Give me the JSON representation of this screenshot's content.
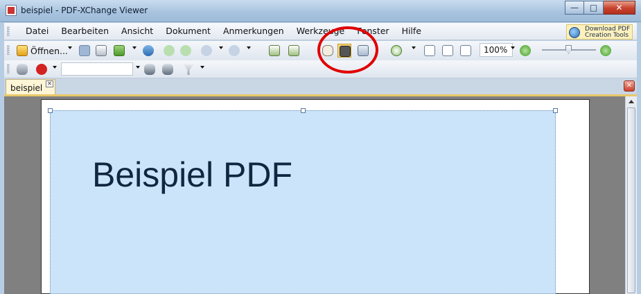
{
  "window": {
    "title": "beispiel - PDF-XChange Viewer"
  },
  "window_controls": {
    "minimize": "—",
    "maximize": "□",
    "close": "✕"
  },
  "menu": {
    "items": [
      "Datei",
      "Bearbeiten",
      "Ansicht",
      "Dokument",
      "Anmerkungen",
      "Werkzeuge",
      "Fenster",
      "Hilfe"
    ]
  },
  "download": {
    "line1": "Download PDF",
    "line2": "Creation Tools"
  },
  "toolbar": {
    "open_label": "Öffnen...",
    "zoom_value": "100%"
  },
  "tabs": {
    "document": "beispiel",
    "tab_close": "×",
    "close_all": "✕"
  },
  "document": {
    "heading": "Beispiel PDF"
  },
  "colors": {
    "accent_red": "#e00000",
    "selection": "#cce4f9",
    "tab_highlight": "#e9c86a"
  },
  "icons": [
    "app-icon",
    "open-folder-icon",
    "save-icon",
    "print-icon",
    "email-icon",
    "back-icon",
    "forward-icon",
    "undo-icon",
    "redo-icon",
    "page-icon",
    "hand-tool-icon",
    "snapshot-icon",
    "text-select-icon",
    "zoom-in-icon",
    "actual-size-icon",
    "fit-page-icon",
    "fit-width-icon",
    "zoom-out-icon",
    "zoom-plus-icon",
    "find-icon",
    "ask-search-icon",
    "prev-result-icon",
    "next-result-icon",
    "filter-icon",
    "download-pdf-icon"
  ]
}
